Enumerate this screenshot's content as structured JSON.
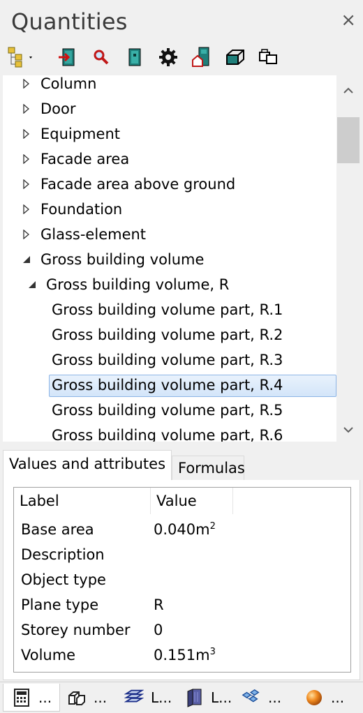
{
  "window": {
    "title": "Quantities",
    "close_glyph": "×"
  },
  "toolbar": {
    "buttons": [
      {
        "name": "tree-view-icon",
        "has_dropdown": true
      },
      {
        "name": "export-icon"
      },
      {
        "name": "search-icon"
      },
      {
        "name": "book-icon"
      },
      {
        "name": "gear-icon"
      },
      {
        "name": "building-icon"
      },
      {
        "name": "surface-icon"
      },
      {
        "name": "copy-objects-icon"
      }
    ]
  },
  "tree": {
    "items": [
      {
        "label": "Column",
        "level": 0,
        "state": "collapsed"
      },
      {
        "label": "Door",
        "level": 0,
        "state": "collapsed"
      },
      {
        "label": "Equipment",
        "level": 0,
        "state": "collapsed"
      },
      {
        "label": "Facade area",
        "level": 0,
        "state": "collapsed"
      },
      {
        "label": "Facade area above ground",
        "level": 0,
        "state": "collapsed"
      },
      {
        "label": "Foundation",
        "level": 0,
        "state": "collapsed"
      },
      {
        "label": "Glass-element",
        "level": 0,
        "state": "collapsed"
      },
      {
        "label": "Gross building volume",
        "level": 0,
        "state": "expanded"
      },
      {
        "label": "Gross building volume, R",
        "level": 1,
        "state": "expanded"
      },
      {
        "label": "Gross building volume part, R.1",
        "level": 2,
        "state": "leaf"
      },
      {
        "label": "Gross building volume part, R.2",
        "level": 2,
        "state": "leaf"
      },
      {
        "label": "Gross building volume part, R.3",
        "level": 2,
        "state": "leaf"
      },
      {
        "label": "Gross building volume part, R.4",
        "level": 2,
        "state": "leaf",
        "selected": true
      },
      {
        "label": "Gross building volume part, R.5",
        "level": 2,
        "state": "leaf"
      },
      {
        "label": "Gross building volume part, R.6",
        "level": 2,
        "state": "leaf"
      }
    ]
  },
  "tabs": {
    "values": "Values and attributes",
    "formulas": "Formulas",
    "active": "values"
  },
  "attributes": {
    "headers": {
      "label": "Label",
      "value": "Value"
    },
    "rows": [
      {
        "label": "Base area",
        "value": "0.040m",
        "sup": "2"
      },
      {
        "label": "Description",
        "value": ""
      },
      {
        "label": "Object type",
        "value": ""
      },
      {
        "label": "Plane type",
        "value": "R"
      },
      {
        "label": "Storey number",
        "value": "0"
      },
      {
        "label": "Volume",
        "value": "0.151m",
        "sup": "3"
      }
    ]
  },
  "bottom_tabs": [
    {
      "name": "calculator-icon",
      "label": "..."
    },
    {
      "name": "3d-boxes-icon",
      "label": "..."
    },
    {
      "name": "layers-icon",
      "label": "L..."
    },
    {
      "name": "library-book-icon",
      "label": "L..."
    },
    {
      "name": "network-icon",
      "label": "..."
    },
    {
      "name": "render-sphere-icon",
      "label": "..."
    }
  ],
  "colors": {
    "selection": "#cce4f7",
    "selection_border": "#8cb4e6"
  }
}
